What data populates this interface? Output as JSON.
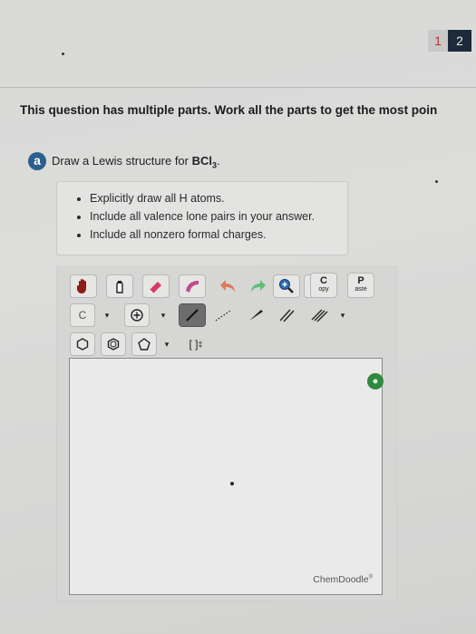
{
  "pagination": {
    "pages": [
      "1",
      "2"
    ],
    "current": "1"
  },
  "instructions": "This question has multiple parts. Work all the parts to get the most poin",
  "part": {
    "label": "a",
    "prompt": "Draw a Lewis structure for ",
    "formula_main": "BCl",
    "formula_sub": "3",
    "formula_end": "."
  },
  "hints": [
    "Explicitly draw all H atoms.",
    "Include all valence lone pairs in your answer.",
    "Include all nonzero formal charges."
  ],
  "toolbar": {
    "copy_top": "C",
    "copy_bottom": "opy",
    "paste_top": "P",
    "paste_bottom": "aste",
    "atom_label": "C",
    "bracket_label": "[ ]",
    "bracket_sup": "‡",
    "dropdown_arrow": "▾"
  },
  "canvas": {
    "brand": "ChemDoodle",
    "brand_mark": "®"
  },
  "colors": {
    "accent": "#2a5f8e",
    "fit_button": "#2f8a3e",
    "active_page": "#c03020"
  },
  "icons": [
    "hand-icon",
    "eraser-icon",
    "clear-icon",
    "undo-icon",
    "redo-icon",
    "zoom-in-icon",
    "zoom-out-icon",
    "charge-plus-icon",
    "single-bond-icon",
    "dashed-bond-icon",
    "wedge-bond-icon",
    "double-bond-icon",
    "triple-bond-icon",
    "hexagon-icon",
    "benzene-icon",
    "pentagon-icon"
  ]
}
